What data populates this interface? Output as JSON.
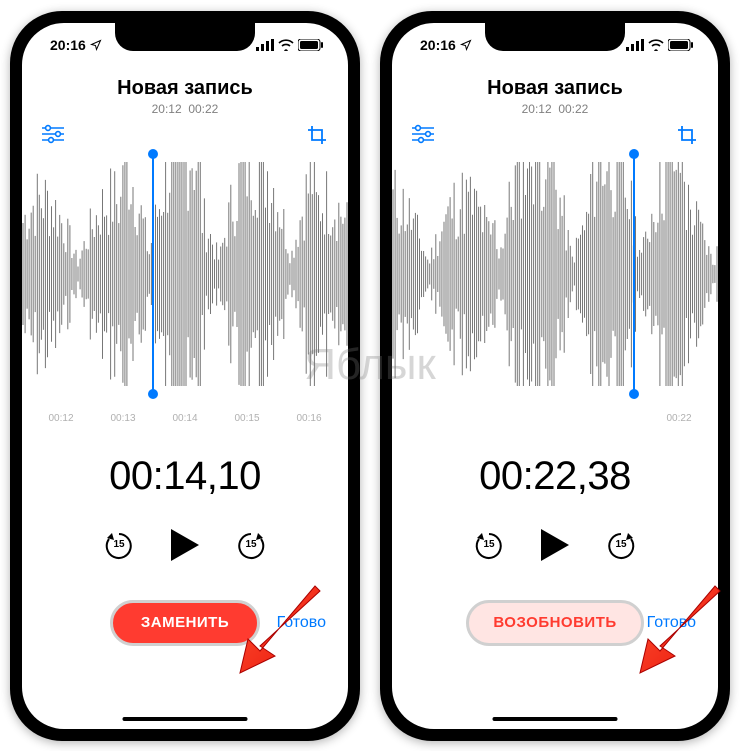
{
  "watermark": "Яблык",
  "phones": [
    {
      "status_time": "20:16",
      "title": "Новая запись",
      "sub_left": "20:12",
      "sub_right": "00:22",
      "ticks": [
        "00:12",
        "00:13",
        "00:14",
        "00:15",
        "00:16"
      ],
      "big_time": "00:14,10",
      "skip_label": "15",
      "action_label": "ЗАМЕНИТЬ",
      "action_variant": "replace",
      "done_label": "Готово",
      "playhead_pct": 40
    },
    {
      "status_time": "20:16",
      "title": "Новая запись",
      "sub_left": "20:12",
      "sub_right": "00:22",
      "ticks": [
        "",
        "",
        "",
        "",
        "00:22"
      ],
      "big_time": "00:22,38",
      "skip_label": "15",
      "action_label": "ВОЗОБНОВИТЬ",
      "action_variant": "resume",
      "done_label": "Готово",
      "playhead_pct": 74
    }
  ]
}
